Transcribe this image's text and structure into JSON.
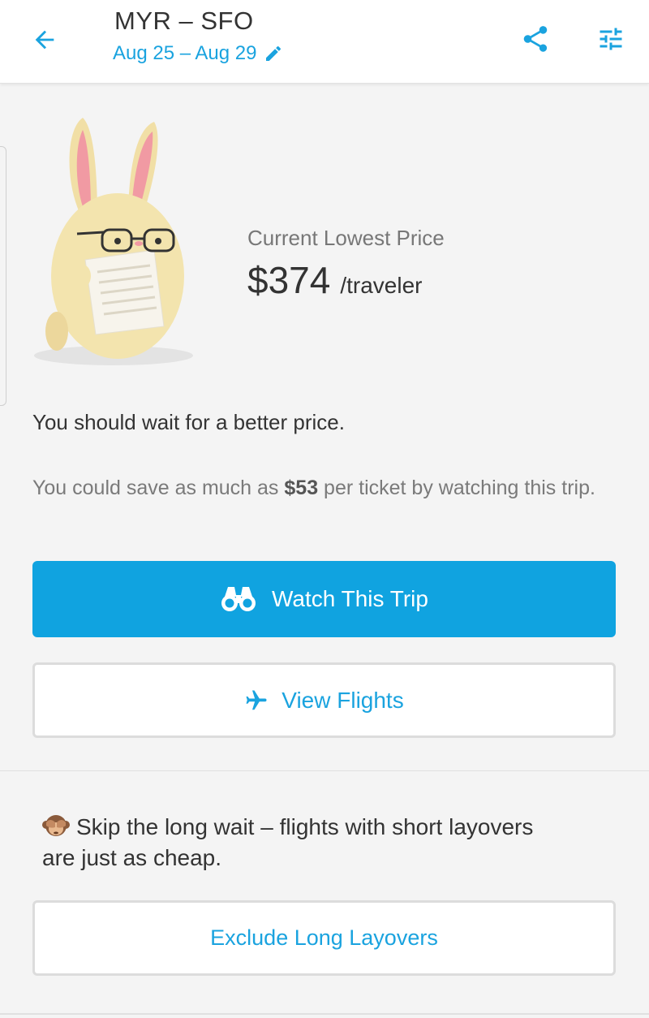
{
  "header": {
    "route": "MYR – SFO",
    "dates": "Aug 25 – Aug 29",
    "back_icon": "arrow-back-icon",
    "edit_icon": "pencil-icon",
    "share_icon": "share-icon",
    "filter_icon": "sliders-icon"
  },
  "prediction": {
    "label": "Current Lowest Price",
    "price": "$374",
    "unit": "/traveler",
    "mascot": "bunny-reading-newspaper"
  },
  "advice": {
    "headline": "You should wait for a better price.",
    "savings_prefix": "You could save as much as ",
    "savings_amount": "$53",
    "savings_suffix": " per ticket by watching this trip."
  },
  "actions": {
    "watch_label": "Watch This Trip",
    "watch_icon": "binoculars-icon",
    "view_label": "View Flights",
    "view_icon": "airplane-icon"
  },
  "tip": {
    "emoji": "see-no-evil-monkey",
    "text": "Skip the long wait – flights with short layovers are just as cheap.",
    "button_label": "Exclude Long Layovers"
  },
  "colors": {
    "accent": "#10a3e0",
    "background": "#f4f4f4",
    "text": "#333333"
  }
}
